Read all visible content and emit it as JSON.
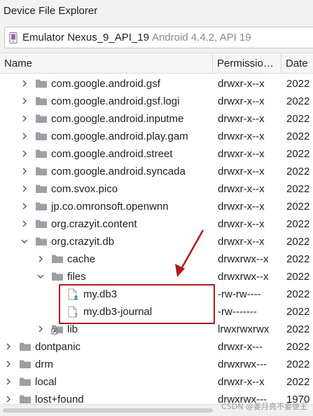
{
  "window": {
    "title": "Device File Explorer"
  },
  "device": {
    "name": "Emulator Nexus_9_API_19",
    "info": "Android 4.4.2, API 19"
  },
  "columns": {
    "name": "Name",
    "permissions": "Permissio…",
    "date": "Date"
  },
  "rows": [
    {
      "depth": 2,
      "expand": "collapsed",
      "icon": "folder",
      "name": "com.google.android.gsf",
      "perm": "drwxr-x--x",
      "date": "2022"
    },
    {
      "depth": 2,
      "expand": "collapsed",
      "icon": "folder",
      "name": "com.google.android.gsf.logi",
      "perm": "drwxr-x--x",
      "date": "2022"
    },
    {
      "depth": 2,
      "expand": "collapsed",
      "icon": "folder",
      "name": "com.google.android.inputme",
      "perm": "drwxr-x--x",
      "date": "2022"
    },
    {
      "depth": 2,
      "expand": "collapsed",
      "icon": "folder",
      "name": "com.google.android.play.gam",
      "perm": "drwxr-x--x",
      "date": "2022"
    },
    {
      "depth": 2,
      "expand": "collapsed",
      "icon": "folder",
      "name": "com.google.android.street",
      "perm": "drwxr-x--x",
      "date": "2022"
    },
    {
      "depth": 2,
      "expand": "collapsed",
      "icon": "folder",
      "name": "com.google.android.syncada",
      "perm": "drwxr-x--x",
      "date": "2022"
    },
    {
      "depth": 2,
      "expand": "collapsed",
      "icon": "folder",
      "name": "com.svox.pico",
      "perm": "drwxr-x--x",
      "date": "2022"
    },
    {
      "depth": 2,
      "expand": "collapsed",
      "icon": "folder",
      "name": "jp.co.omronsoft.openwnn",
      "perm": "drwxr-x--x",
      "date": "2022"
    },
    {
      "depth": 2,
      "expand": "collapsed",
      "icon": "folder",
      "name": "org.crazyit.content",
      "perm": "drwxr-x--x",
      "date": "2022"
    },
    {
      "depth": 2,
      "expand": "expanded",
      "icon": "folder",
      "name": "org.crazyit.db",
      "perm": "drwxr-x--x",
      "date": "2022"
    },
    {
      "depth": 3,
      "expand": "collapsed",
      "icon": "folder",
      "name": "cache",
      "perm": "drwxrwx--x",
      "date": "2022"
    },
    {
      "depth": 3,
      "expand": "expanded",
      "icon": "folder",
      "name": "files",
      "perm": "drwxrwx--x",
      "date": "2022"
    },
    {
      "depth": 4,
      "expand": "none",
      "icon": "file-user",
      "name": "my.db3",
      "perm": "-rw-rw----",
      "date": "2022"
    },
    {
      "depth": 4,
      "expand": "none",
      "icon": "file-unknown",
      "name": "my.db3-journal",
      "perm": "-rw-------",
      "date": "2022"
    },
    {
      "depth": 3,
      "expand": "collapsed",
      "icon": "link",
      "name": "lib",
      "perm": "lrwxrwxrwx",
      "date": "2022"
    },
    {
      "depth": 1,
      "expand": "collapsed",
      "icon": "folder",
      "name": "dontpanic",
      "perm": "drwxr-x---",
      "date": "2022"
    },
    {
      "depth": 1,
      "expand": "collapsed",
      "icon": "folder",
      "name": "drm",
      "perm": "drwxrwx---",
      "date": "2022"
    },
    {
      "depth": 1,
      "expand": "collapsed",
      "icon": "folder",
      "name": "local",
      "perm": "drwxr-x--x",
      "date": "2022"
    },
    {
      "depth": 1,
      "expand": "collapsed",
      "icon": "folder",
      "name": "lost+found",
      "perm": "drwxrwx---",
      "date": "1970"
    }
  ],
  "watermark": "CSDN @姜月亮不要便王",
  "colors": {
    "folder": "#9aa0a6",
    "highlight": "#b01c1c",
    "user_badge": "#3b8bd8"
  }
}
